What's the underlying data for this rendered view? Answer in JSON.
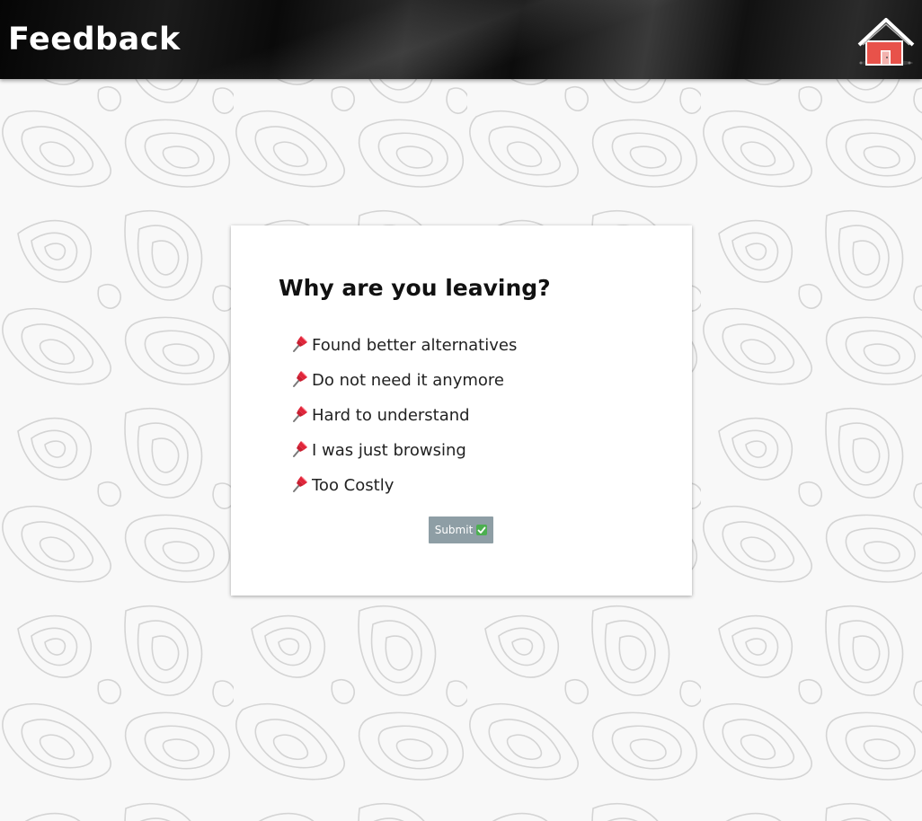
{
  "header": {
    "title": "Feedback",
    "home_icon": "home-icon"
  },
  "card": {
    "heading": "Why are you leaving?",
    "reasons": [
      {
        "label": "Found better alternatives",
        "icon": "pushpin-icon"
      },
      {
        "label": "Do not need it anymore",
        "icon": "pushpin-icon"
      },
      {
        "label": "Hard to understand",
        "icon": "pushpin-icon"
      },
      {
        "label": "I was just browsing",
        "icon": "pushpin-icon"
      },
      {
        "label": "Too Costly",
        "icon": "pushpin-icon"
      }
    ],
    "submit_label": "Submit",
    "submit_icon": "check-mark-icon"
  },
  "colors": {
    "header_bg": "#111111",
    "card_bg": "#ffffff",
    "submit_bg": "#8e9ea5",
    "pin_red": "#e0253a",
    "house_red": "#e8524a",
    "check_green": "#4caf50"
  }
}
